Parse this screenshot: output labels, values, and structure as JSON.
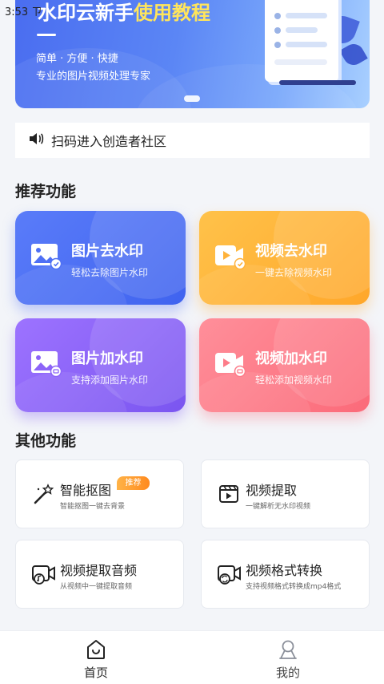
{
  "status_bar": {
    "time": "3:53",
    "carrier_glyph": "ㄗ"
  },
  "banner": {
    "title_plain": "水印云新手",
    "title_highlight": "使用教程",
    "subtitle1": "简单 · 方便 · 快捷",
    "subtitle2": "专业的图片视频处理专家"
  },
  "notice": {
    "text": "扫码进入创造者社区",
    "icon": "speaker-icon"
  },
  "recommended": {
    "heading": "推荐功能",
    "cards": [
      {
        "title": "图片去水印",
        "subtitle": "轻松去除图片水印",
        "icon": "image-remove-icon",
        "color": "#4f70f5"
      },
      {
        "title": "视频去水印",
        "subtitle": "一键去除视频水印",
        "icon": "video-remove-icon",
        "color": "#ffb23a"
      },
      {
        "title": "图片加水印",
        "subtitle": "支持添加图片水印",
        "icon": "image-add-icon",
        "color": "#8c64f8"
      },
      {
        "title": "视频加水印",
        "subtitle": "轻松添加视频水印",
        "icon": "video-add-icon",
        "color": "#fd7c89"
      }
    ]
  },
  "other": {
    "heading": "其他功能",
    "items": [
      {
        "title": "智能抠图",
        "subtitle": "智能抠图一键去背景",
        "badge": "推荐",
        "icon": "magic-wand-icon"
      },
      {
        "title": "视频提取",
        "subtitle": "一键解析无水印视频",
        "icon": "video-extract-icon"
      },
      {
        "title": "视频提取音频",
        "subtitle": "从视频中一键提取音频",
        "icon": "audio-extract-icon"
      },
      {
        "title": "视频格式转换",
        "subtitle": "支持视频格式转换成mp4格式",
        "icon": "format-convert-icon"
      }
    ]
  },
  "tabbar": {
    "tabs": [
      {
        "label": "首页",
        "active": true,
        "icon": "home-icon"
      },
      {
        "label": "我的",
        "active": false,
        "icon": "profile-icon"
      }
    ],
    "active_color": "#222222",
    "inactive_color": "#444444"
  }
}
